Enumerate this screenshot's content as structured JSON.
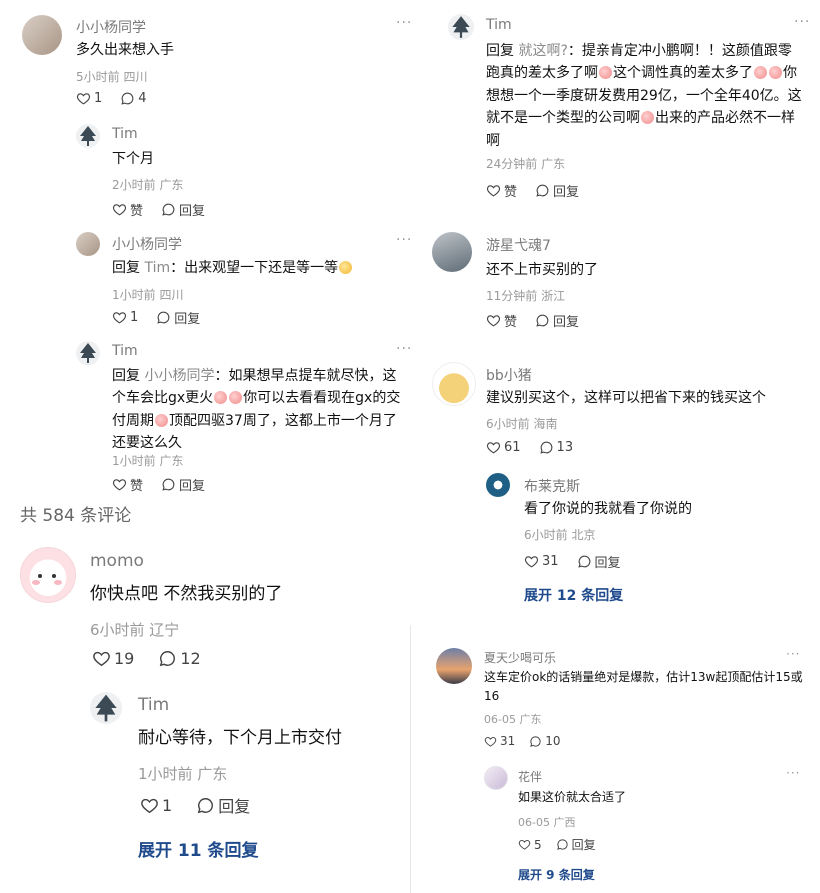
{
  "colors": {
    "link": "#1f4a8c",
    "meta": "#9a9a9a",
    "name": "#7a7a7a"
  },
  "icons": {
    "like": "heart-icon",
    "reply": "comment-bubble-icon",
    "more": "more-dots-icon"
  },
  "panel_a": {
    "c1": {
      "name": "小小杨同学",
      "text": "多久出来想入手",
      "meta": "5小时前 四川",
      "likes": "1",
      "replies": "4"
    },
    "r1": {
      "name": "Tim",
      "text": "下个月",
      "meta": "2小时前 广东",
      "like": "赞",
      "reply": "回复"
    },
    "r2": {
      "name": "小小杨同学",
      "reply_prefix": "回复 ",
      "reply_target": "Tim",
      "text": "：出来观望一下还是等一等",
      "meta": "1小时前 四川",
      "likes": "1",
      "reply": "回复"
    },
    "r3": {
      "name": "Tim",
      "reply_prefix": "回复 ",
      "reply_target": "小小杨同学",
      "text1": "：如果想早点提车就尽快，这个车会比gx更火",
      "text2": "你可以去看看现在gx的交付周期",
      "text3": "顶配四驱37周了，这都上市一个月了还要这么久",
      "meta": "1小时前 广东",
      "like": "赞",
      "reply": "回复"
    }
  },
  "total_comments": "共 584 条评论",
  "panel_b": {
    "c1": {
      "name": "momo",
      "text": "你快点吧 不然我买别的了",
      "meta": "6小时前 辽宁",
      "likes": "19",
      "replies": "12"
    },
    "r1": {
      "name": "Tim",
      "text": "耐心等待，下个月上市交付",
      "meta": "1小时前 广东",
      "likes": "1",
      "reply": "回复"
    },
    "expand": "展开 11 条回复"
  },
  "panel_c": {
    "c1": {
      "name": "Tim",
      "reply_prefix": "回复 ",
      "reply_target": "就这啊?",
      "text1": "：提亲肯定冲小鹏啊！！这颜值跟零跑真的差太多了啊",
      "text2": "这个调性真的差太多了",
      "text3": "你想想一个一季度研发费用29亿，一个全年40亿。这就不是一个类型的公司啊",
      "text4": "出来的产品必然不一样啊",
      "meta": "24分钟前 广东",
      "like": "赞",
      "reply": "回复"
    },
    "c2": {
      "name": "游星弋魂7",
      "text": "还不上市买别的了",
      "meta": "11分钟前 浙江",
      "like": "赞",
      "reply": "回复"
    },
    "c3": {
      "name": "bb小猪",
      "text": "建议别买这个，这样可以把省下来的钱买这个",
      "meta": "6小时前 海南",
      "likes": "61",
      "replies": "13"
    },
    "r1": {
      "name": "布莱克斯",
      "text": "看了你说的我就看了你说的",
      "meta": "6小时前 北京",
      "likes": "31",
      "reply": "回复"
    },
    "expand": "展开 12 条回复"
  },
  "panel_d": {
    "c1": {
      "name": "夏天少喝可乐",
      "text": "这车定价ok的话销量绝对是爆款，估计13w起顶配估计15或16",
      "meta": "06-05 广东",
      "likes": "31",
      "replies": "10"
    },
    "r1": {
      "name": "花伴",
      "text": "如果这价就太合适了",
      "meta": "06-05 广西",
      "likes": "5",
      "reply": "回复"
    },
    "expand": "展开 9 条回复"
  }
}
